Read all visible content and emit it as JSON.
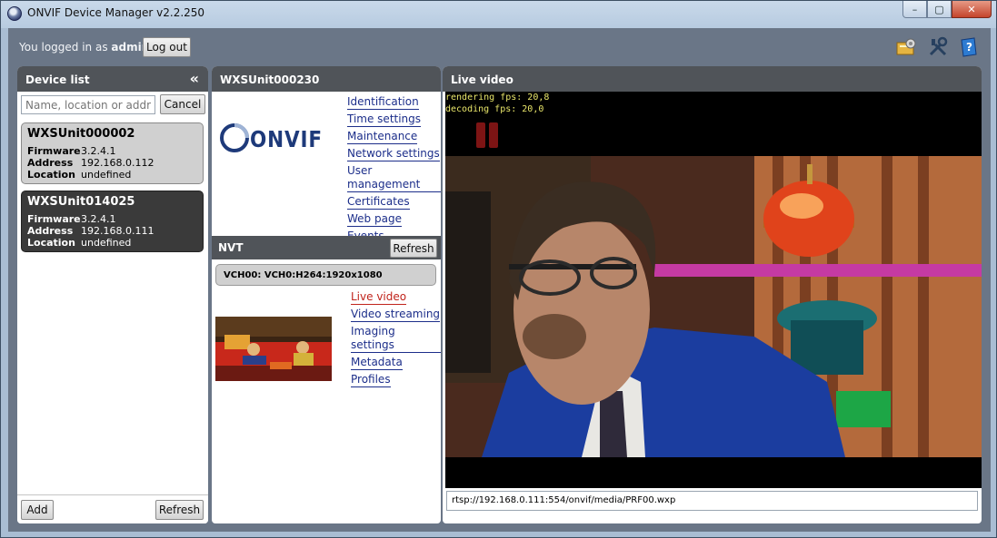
{
  "window": {
    "title": "ONVIF Device Manager v2.2.250",
    "minimize_glyph": "–",
    "maximize_glyph": "▢",
    "close_glyph": "✕"
  },
  "topbar": {
    "login_prefix": "You logged in as",
    "username": "admin",
    "logout_label": "Log out"
  },
  "device_list": {
    "title": "Device list",
    "collapse_glyph": "«",
    "search_placeholder": "Name, location or address",
    "cancel_label": "Cancel",
    "devices": [
      {
        "name": "WXSUnit000002",
        "firmware": "3.2.4.1",
        "address": "192.168.0.112",
        "location": "undefined"
      },
      {
        "name": "WXSUnit014025",
        "firmware": "3.2.4.1",
        "address": "192.168.0.111",
        "location": "undefined"
      }
    ],
    "labels": {
      "firmware": "Firmware",
      "address": "Address",
      "location": "Location"
    },
    "add_label": "Add",
    "refresh_label": "Refresh"
  },
  "device_detail": {
    "title": "WXSUnit000230",
    "logo_text": "ONVIF",
    "links": [
      "Identification",
      "Time settings",
      "Maintenance",
      "Network settings",
      "User management",
      "Certificates",
      "Web page",
      "Events"
    ],
    "nvt_title": "NVT",
    "nvt_refresh_label": "Refresh",
    "profile": "VCH00: VCH0:H264:1920x1080",
    "profile_links": [
      "Live video",
      "Video streaming",
      "Imaging settings",
      "Metadata",
      "Profiles"
    ]
  },
  "live_video": {
    "title": "Live video",
    "rendering_fps": "rendering fps: 20,8",
    "decoding_fps": "decoding fps: 20,0",
    "stream_url": "rtsp://192.168.0.111:554/onvif/media/PRF00.wxp"
  },
  "colors": {
    "header_bg": "#505459",
    "link": "#1c2e8a",
    "active_link": "#c0231b",
    "selected_card": "#3a3a3a"
  }
}
